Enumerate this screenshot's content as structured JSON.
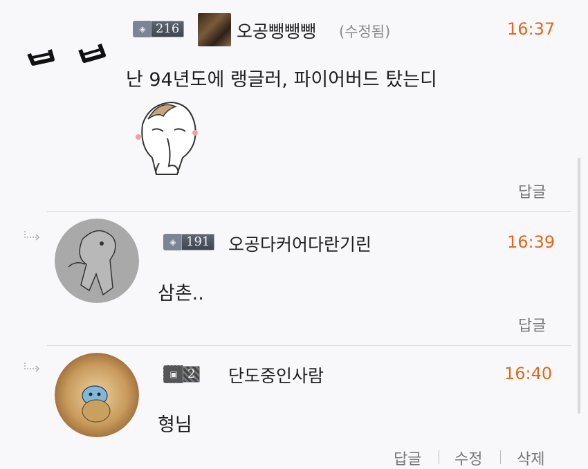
{
  "comments": [
    {
      "level": "216",
      "nickname": "오공뺑뺑뺑",
      "edited_label": "(수정됨)",
      "time": "16:37",
      "text": "난 94년도에 랭글러, 파이어버드 탔는디",
      "actions": [
        "답글"
      ]
    },
    {
      "level": "191",
      "nickname": "오공다커어다란기린",
      "time": "16:39",
      "text": "삼촌..",
      "actions": [
        "답글"
      ]
    },
    {
      "level": "2",
      "nickname": "단도중인사람",
      "time": "16:40",
      "text": "형님",
      "actions": [
        "답글",
        "수정",
        "삭제"
      ]
    }
  ],
  "colors": {
    "time": "#e0691a",
    "background": "#f8f8fa",
    "divider": "#dcdcdc",
    "action_text": "#777777"
  },
  "icons": [
    "reply-arrow-icon",
    "level-badge-icon",
    "sticker-image",
    "avatar-image"
  ]
}
